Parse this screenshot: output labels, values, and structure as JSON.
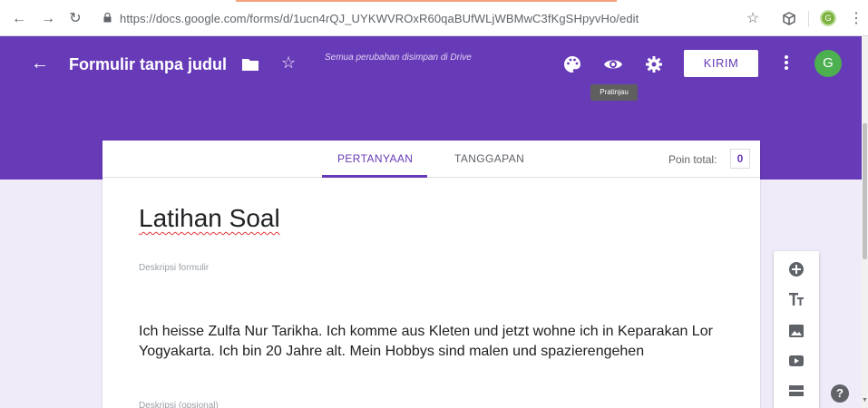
{
  "browser": {
    "url": "https://docs.google.com/forms/d/1ucn4rQJ_UYKWVROxR60qaBUfWLjWBMwC3fKgSHpyvHo/edit",
    "extension_avatar": "G",
    "icons": [
      "back-arrow-icon",
      "forward-arrow-icon",
      "reload-icon",
      "lock-icon",
      "bookmark-star-icon",
      "extension-cube-icon",
      "more-vert-icon"
    ]
  },
  "header": {
    "title": "Formulir tanpa judul",
    "save_status": "Semua perubahan disimpan di Drive",
    "send_label": "KIRIM",
    "preview_tooltip": "Pratinjau",
    "avatar_letter": "G",
    "accent_color": "#673ab7",
    "icons": [
      "back-arrow-icon",
      "folder-icon",
      "star-icon",
      "palette-icon",
      "eye-icon",
      "gear-icon",
      "more-vert-icon"
    ]
  },
  "tabs": {
    "questions": "PERTANYAAN",
    "responses": "TANGGAPAN",
    "active": "PERTANYAAN"
  },
  "points": {
    "label": "Poin total:",
    "value": "0"
  },
  "form": {
    "title": "Latihan Soal",
    "description_placeholder": "Deskripsi formulir",
    "body_text": "Ich heisse Zulfa Nur Tarikha. Ich komme aus Kleten und jetzt wohne ich in Keparakan Lor Yogyakarta. Ich bin 20 Jahre alt. Mein Hobbys sind malen und spazierengehen",
    "optional_description": "Deskripsi (opsional)"
  },
  "toolbar": {
    "icons": [
      "add-circle-icon",
      "title-text-icon",
      "image-icon",
      "video-icon",
      "section-icon"
    ]
  },
  "help_label": "?"
}
